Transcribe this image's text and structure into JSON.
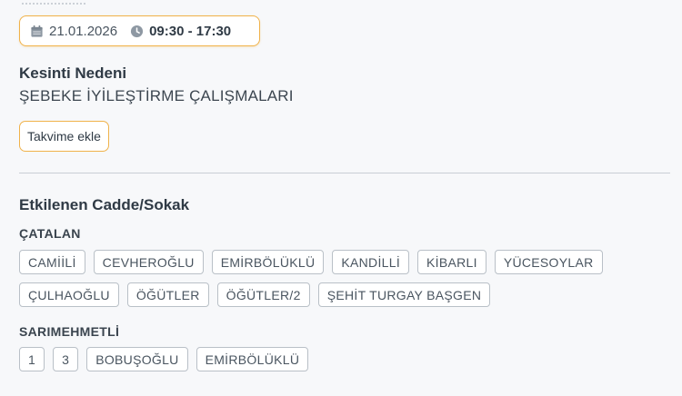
{
  "outage": {
    "date": "21.01.2026",
    "time_range": "09:30 - 17:30",
    "reason_label": "Kesinti Nedeni",
    "reason": "ŞEBEKE İYİLEŞTİRME ÇALIŞMALARI",
    "add_to_calendar_label": "Takvime ekle"
  },
  "streets": {
    "title": "Etkilenen Cadde/Sokak",
    "groups": [
      {
        "district": "ÇATALAN",
        "rows": [
          [
            "CAMİİLİ",
            "CEVHEROĞLU",
            "EMİRBÖLÜKLÜ",
            "KANDİLLİ",
            "KİBARLI",
            "YÜCESOYLAR"
          ],
          [
            "ÇULHAOĞLU",
            "ÖĞÜTLER",
            "ÖĞÜTLER/2",
            "ŞEHİT TURGAY BAŞGEN"
          ]
        ]
      },
      {
        "district": "SARIMEHMETLİ",
        "rows": [
          [
            "1",
            "3",
            "BOBUŞOĞLU",
            "EMİRBÖLÜKLÜ"
          ]
        ]
      }
    ]
  },
  "icons": {
    "date": "calendar-icon",
    "time": "clock-icon"
  },
  "colors": {
    "accent_border": "#f0b24a",
    "tag_border": "#b9c0c7",
    "background": "#f7f8fa"
  }
}
